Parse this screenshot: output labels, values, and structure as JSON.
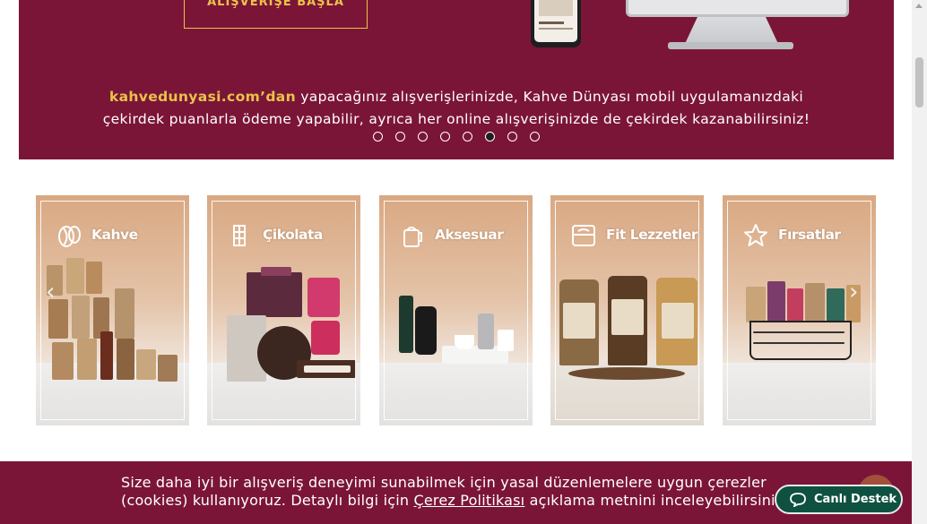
{
  "hero": {
    "cta_label": "ALIŞVERİŞE BAŞLA",
    "line1_brand": "kahvedunyasi.com’dan",
    "line1_rest": " yapacağınız alışverişlerinizde, Kahve Dünyası mobil uygulamanızdaki",
    "line2": "çekirdek puanlarla ödeme yapabilir, ayrıca her online alışverişinizde de çekirdek kazanabilirsiniz!",
    "slide_count": 8,
    "active_slide": 6
  },
  "categories": [
    {
      "label": "Kahve",
      "icon": "coffee-bean-icon"
    },
    {
      "label": "Çikolata",
      "icon": "chocolate-icon"
    },
    {
      "label": "Aksesuar",
      "icon": "coffee-pot-icon"
    },
    {
      "label": "Fit Lezzetler",
      "icon": "scale-icon"
    },
    {
      "label": "Fırsatlar",
      "icon": "star-icon"
    }
  ],
  "cookie": {
    "text_before": "Size daha iyi bir alışveriş deneyimi sunabilmek için yasal düzenlemelere uygun çerezler (cookies) kullanıyoruz. Detaylı bilgi için ",
    "link": "Çerez Politikası",
    "text_after": " açıklama metnini inceleyebilirsiniz."
  },
  "support": {
    "label": "Canlı Destek"
  },
  "colors": {
    "brand": "#7b1538",
    "accent": "#e9c349",
    "support": "#0f5140"
  }
}
